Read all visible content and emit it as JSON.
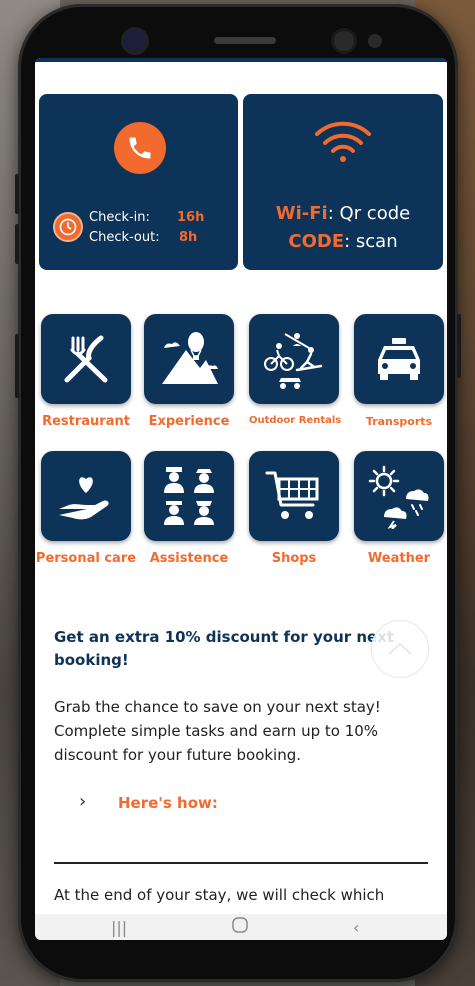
{
  "colors": {
    "navy": "#0e3358",
    "orange": "#f26a2e"
  },
  "top_cards": {
    "call": {
      "icon": "phone-icon"
    },
    "checkin": {
      "checkin_label": "Check-in:",
      "checkin_time": "16h",
      "checkout_label": "Check-out:",
      "checkout_time": "8h",
      "icon": "clock-icon"
    },
    "wifi": {
      "icon": "wifi-icon",
      "wifi_key": "Wi-Fi",
      "wifi_value": ": Qr code",
      "code_key": "CODE",
      "code_value": ": scan"
    }
  },
  "services": [
    {
      "label": "Restraurant",
      "icon": "fork-knife-icon"
    },
    {
      "label": "Experience",
      "icon": "mountain-balloon-icon"
    },
    {
      "label": "Outdoor Rentals",
      "icon": "outdoor-sports-icon"
    },
    {
      "label": "Transports",
      "icon": "taxi-icon"
    },
    {
      "label": "Personal care",
      "icon": "hand-heart-icon"
    },
    {
      "label": "Assistence",
      "icon": "staff-icon"
    },
    {
      "label": "Shops",
      "icon": "shopping-cart-icon"
    },
    {
      "label": "Weather",
      "icon": "weather-icon"
    }
  ],
  "promo": {
    "title": "Get an extra 10% discount for your next booking!",
    "body": "Grab the chance to save on your next stay! Complete simple tasks and earn up to 10% discount for your future booking.",
    "how_label": "Here's how:",
    "footer_text": "At the end of your stay, we will check which"
  }
}
